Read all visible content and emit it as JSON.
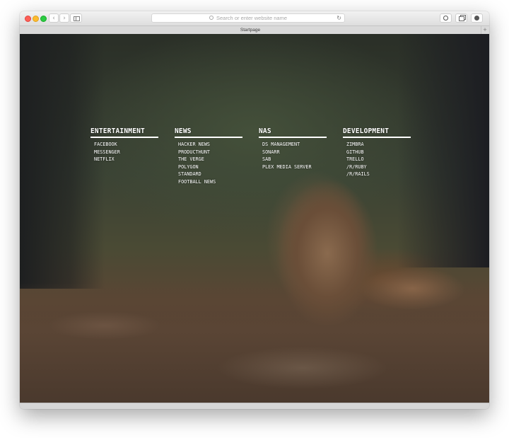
{
  "browser": {
    "url_placeholder": "Search or enter website name",
    "tab_title": "Startpage",
    "new_tab_label": "+",
    "back_glyph": "‹",
    "forward_glyph": "›",
    "reload_glyph": "↻",
    "icons": {
      "close": "close-icon",
      "minimize": "minimize-icon",
      "maximize": "maximize-icon",
      "sidebar": "sidebar-icon",
      "search": "search-icon",
      "reload": "reload-icon"
    }
  },
  "startpage": {
    "categories": [
      {
        "title": "ENTERTAINMENT",
        "links": [
          "FACEBOOK",
          "MESSENGER",
          "NETFLIX"
        ]
      },
      {
        "title": "NEWS",
        "links": [
          "HACKER NEWS",
          "PRODUCTHUNT",
          "THE VERGE",
          "POLYGON",
          "STANDARD",
          "FOOTBALL NEWS"
        ]
      },
      {
        "title": "NAS",
        "links": [
          "DS MANAGEMENT",
          "SONARR",
          "SAB",
          "PLEX MEDIA SERVER"
        ]
      },
      {
        "title": "DEVELOPMENT",
        "links": [
          "ZIMBRA",
          "GITHUB",
          "TRELLO",
          "/R/RUBY",
          "/R/RAILS"
        ]
      }
    ],
    "colors": {
      "text": "#ffffff",
      "underline": "#ffffff"
    }
  }
}
